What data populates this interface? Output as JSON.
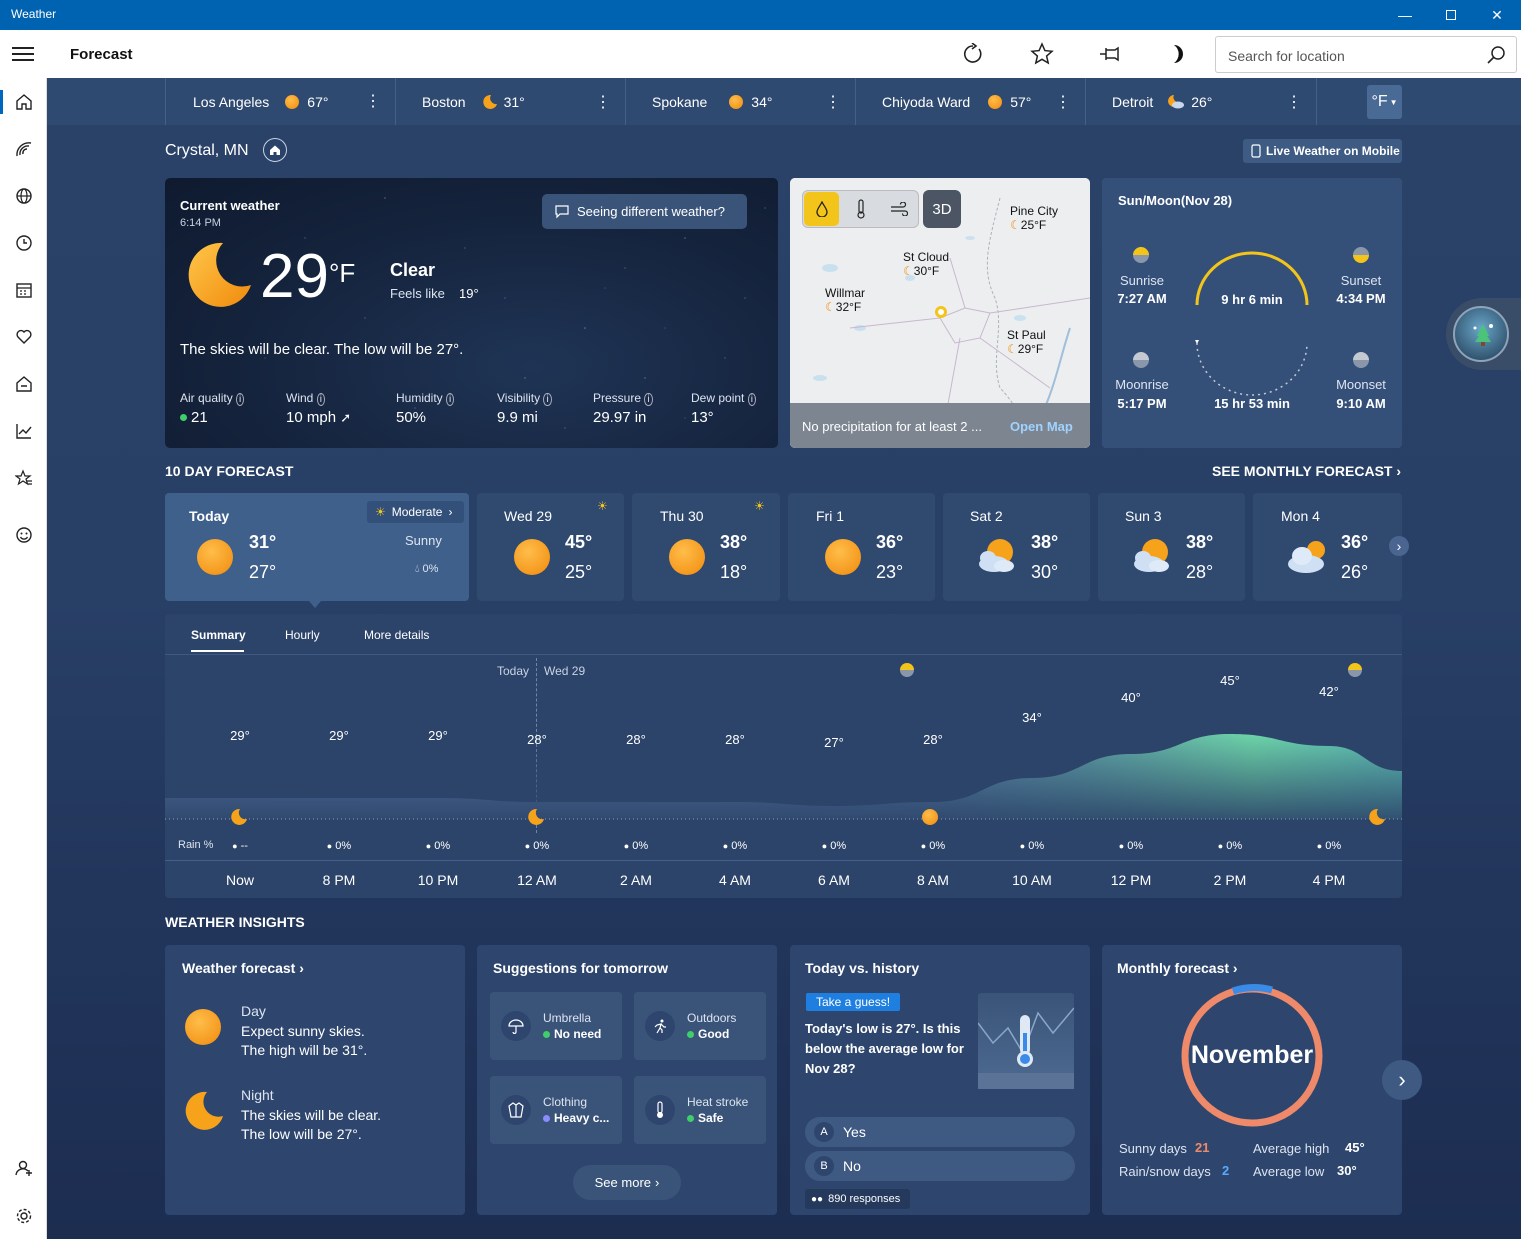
{
  "window": {
    "title": "Weather"
  },
  "appbar": {
    "title": "Forecast",
    "search_placeholder": "Search for location"
  },
  "cities": [
    {
      "name": "Los Angeles",
      "temp": "67°",
      "icon": "sun-icon"
    },
    {
      "name": "Boston",
      "temp": "31°",
      "icon": "moon-icon"
    },
    {
      "name": "Spokane",
      "temp": "34°",
      "icon": "sun-icon"
    },
    {
      "name": "Chiyoda Ward",
      "temp": "57°",
      "icon": "sun-icon"
    },
    {
      "name": "Detroit",
      "temp": "26°",
      "icon": "partly-cloudy-night-icon"
    }
  ],
  "unit": "°F",
  "location": "Crystal, MN",
  "live_mobile": "Live Weather on Mobile",
  "current": {
    "title": "Current weather",
    "time": "6:14 PM",
    "temp": "29",
    "unit": "°F",
    "condition": "Clear",
    "feels_like_label": "Feels like",
    "feels_like": "19°",
    "different": "Seeing different weather?",
    "summary": "The skies will be clear. The low will be 27°.",
    "stats": [
      {
        "label": "Air quality",
        "value": "21"
      },
      {
        "label": "Wind",
        "value": "10 mph"
      },
      {
        "label": "Humidity",
        "value": "50%"
      },
      {
        "label": "Visibility",
        "value": "9.9 mi"
      },
      {
        "label": "Pressure",
        "value": "29.97 in"
      },
      {
        "label": "Dew point",
        "value": "13°"
      }
    ]
  },
  "map": {
    "button_3d": "3D",
    "places": [
      {
        "name": "Pine City",
        "temp": "25°F"
      },
      {
        "name": "St Cloud",
        "temp": "30°F"
      },
      {
        "name": "Willmar",
        "temp": "32°F"
      },
      {
        "name": "St Paul",
        "temp": "29°F"
      }
    ],
    "status": "No precipitation for at least 2 ...",
    "open": "Open Map"
  },
  "sunmoon": {
    "title": "Sun/Moon(Nov 28)",
    "sunrise_label": "Sunrise",
    "sunrise": "7:27 AM",
    "sunset_label": "Sunset",
    "sunset": "4:34 PM",
    "day_length": "9 hr 6 min",
    "moonrise_label": "Moonrise",
    "moonrise": "5:17 PM",
    "moonset_label": "Moonset",
    "moonset": "9:10 AM",
    "moon_length": "15 hr 53 min"
  },
  "forecast": {
    "title": "10 DAY FORECAST",
    "monthly": "SEE MONTHLY FORECAST",
    "days": [
      {
        "day": "Today",
        "high": "31°",
        "low": "27°",
        "badge": "Moderate",
        "cond": "Sunny",
        "rain": "0%"
      },
      {
        "day": "Wed 29",
        "high": "45°",
        "low": "25°"
      },
      {
        "day": "Thu 30",
        "high": "38°",
        "low": "18°"
      },
      {
        "day": "Fri 1",
        "high": "36°",
        "low": "23°"
      },
      {
        "day": "Sat 2",
        "high": "38°",
        "low": "30°"
      },
      {
        "day": "Sun 3",
        "high": "38°",
        "low": "28°"
      },
      {
        "day": "Mon 4",
        "high": "36°",
        "low": "26°"
      }
    ]
  },
  "hourly": {
    "tabs": [
      "Summary",
      "Hourly",
      "More details"
    ],
    "today": "Today",
    "wed": "Wed 29",
    "rain_label": "Rain %",
    "temps": [
      "29°",
      "29°",
      "29°",
      "28°",
      "28°",
      "28°",
      "27°",
      "28°",
      "34°",
      "40°",
      "45°",
      "42°"
    ],
    "temp_values": [
      29,
      29,
      29,
      28,
      28,
      28,
      27,
      28,
      34,
      40,
      45,
      42
    ],
    "rain": [
      "--",
      "0%",
      "0%",
      "0%",
      "0%",
      "0%",
      "0%",
      "0%",
      "0%",
      "0%",
      "0%",
      "0%"
    ],
    "times": [
      "Now",
      "8 PM",
      "10 PM",
      "12 AM",
      "2 AM",
      "4 AM",
      "6 AM",
      "8 AM",
      "10 AM",
      "12 PM",
      "2 PM",
      "4 PM"
    ]
  },
  "insights": {
    "title": "WEATHER INSIGHTS",
    "forecast": {
      "title": "Weather forecast",
      "day_label": "Day",
      "day_text1": "Expect sunny skies.",
      "day_text2": "The high will be 31°.",
      "night_label": "Night",
      "night_text1": "The skies will be clear.",
      "night_text2": "The low will be 27°."
    },
    "suggestions": {
      "title": "Suggestions for tomorrow",
      "items": [
        {
          "name": "Umbrella",
          "value": "No need",
          "color": "#3ecf6a"
        },
        {
          "name": "Outdoors",
          "value": "Good",
          "color": "#3ecf6a"
        },
        {
          "name": "Clothing",
          "value": "Heavy c...",
          "color": "#8b8bff"
        },
        {
          "name": "Heat stroke",
          "value": "Safe",
          "color": "#3ecf6a"
        }
      ],
      "more": "See more"
    },
    "history": {
      "title": "Today vs. history",
      "badge": "Take a guess!",
      "question": "Today's low is 27°. Is this below the average low for Nov 28?",
      "options": [
        {
          "key": "A",
          "text": "Yes"
        },
        {
          "key": "B",
          "text": "No"
        }
      ],
      "responses": "890 responses"
    },
    "monthly": {
      "title": "Monthly forecast",
      "month": "November",
      "sunny_label": "Sunny days",
      "sunny": "21",
      "rain_label": "Rain/snow days",
      "rain": "2",
      "high_label": "Average high",
      "high": "45°",
      "low_label": "Average low",
      "low": "30°"
    }
  }
}
